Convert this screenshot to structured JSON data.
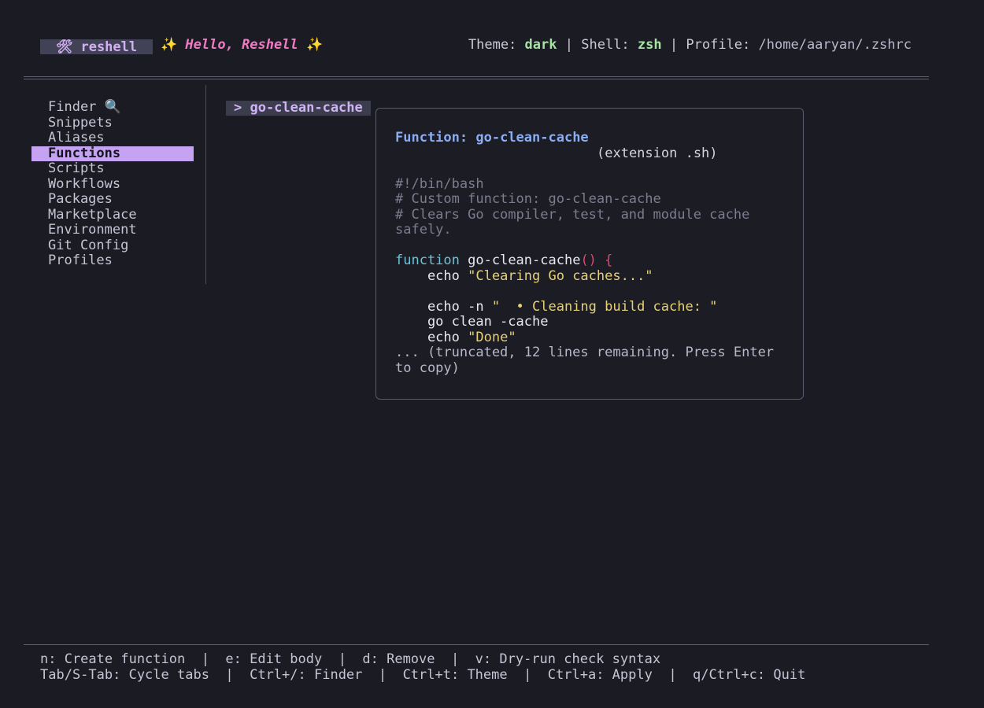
{
  "header": {
    "app_icon": "🛠",
    "app_name": "reshell",
    "sparkle": "✨",
    "greeting": "Hello, Reshell",
    "theme_label": "Theme:",
    "theme_value": "dark",
    "shell_label": "Shell:",
    "shell_value": "zsh",
    "profile_label": "Profile:",
    "profile_value": "/home/aaryan/.zshrc",
    "separator": "|"
  },
  "sidebar": {
    "items": [
      {
        "label": "Finder 🔍",
        "active": false
      },
      {
        "label": "Snippets",
        "active": false
      },
      {
        "label": "Aliases",
        "active": false
      },
      {
        "label": "Functions",
        "active": true
      },
      {
        "label": "Scripts",
        "active": false
      },
      {
        "label": "Workflows",
        "active": false
      },
      {
        "label": "Packages",
        "active": false
      },
      {
        "label": "Marketplace",
        "active": false
      },
      {
        "label": "Environment",
        "active": false
      },
      {
        "label": "Git Config",
        "active": false
      },
      {
        "label": "Profiles",
        "active": false
      }
    ]
  },
  "list": {
    "selected_item": "> go-clean-cache"
  },
  "preview": {
    "title_prefix": "Function:",
    "title_name": "go-clean-cache",
    "extension": "(extension .sh)",
    "comment1": "#!/bin/bash",
    "comment2": "# Custom function: go-clean-cache",
    "comment3": "# Clears Go compiler, test, and module cache",
    "comment4": "safely.",
    "kw_function": "function",
    "fn_name": "go-clean-cache",
    "parens": "()",
    "brace": "{",
    "echo1_cmd": "    echo",
    "echo1_str": "\"Clearing Go caches...\"",
    "echo2_cmd": "    echo -n",
    "echo2_str": "\"  • Cleaning build cache: \"",
    "go_cmd": "    go clean -cache",
    "echo3_cmd": "    echo",
    "echo3_str": "\"Done\"",
    "truncated": "... (truncated, 12 lines remaining. Press Enter to copy)"
  },
  "footer": {
    "line1": "n: Create function  |  e: Edit body  |  d: Remove  |  v: Dry-run check syntax",
    "line2": "Tab/S-Tab: Cycle tabs  |  Ctrl+/: Finder  |  Ctrl+t: Theme  |  Ctrl+a: Apply  |  q/Ctrl+c: Quit"
  }
}
